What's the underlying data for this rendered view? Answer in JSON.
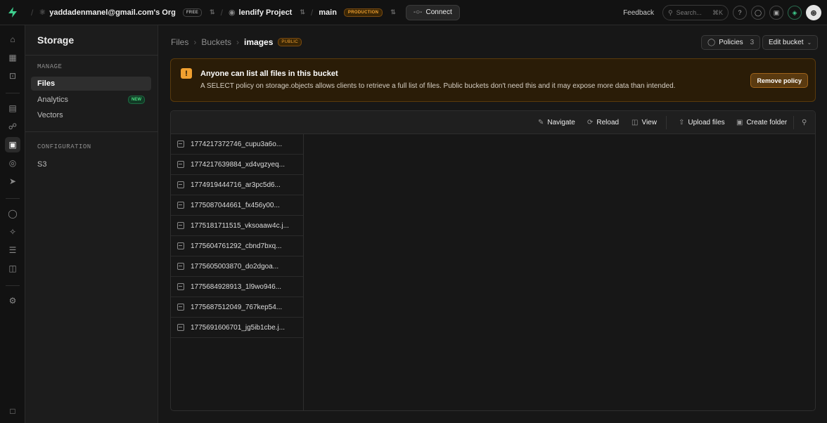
{
  "topbar": {
    "org_name": "yaddadenmanel@gmail.com's Org",
    "org_plan": "FREE",
    "project_name": "lendify Project",
    "branch_name": "main",
    "branch_badge": "PRODUCTION",
    "connect_label": "Connect",
    "feedback_label": "Feedback",
    "search_placeholder": "Search...",
    "search_shortcut": "⌘K",
    "avatar_initial": "⊛"
  },
  "sidebar": {
    "title": "Storage",
    "manage_label": "MANAGE",
    "items": [
      {
        "label": "Files"
      },
      {
        "label": "Analytics",
        "badge": "NEW"
      },
      {
        "label": "Vectors"
      }
    ],
    "configuration_label": "CONFIGURATION",
    "config_items": [
      {
        "label": "S3"
      }
    ]
  },
  "header": {
    "breadcrumb": [
      "Files",
      "Buckets",
      "images"
    ],
    "bucket_badge": "PUBLIC",
    "policies_label": "Policies",
    "policies_count": "3",
    "edit_bucket_label": "Edit bucket"
  },
  "warning": {
    "title": "Anyone can list all files in this bucket",
    "text": "A SELECT policy on storage.objects allows clients to retrieve a full list of files. Public buckets don't need this and it may expose more data than intended.",
    "button_label": "Remove policy"
  },
  "toolbar": {
    "navigate": "Navigate",
    "reload": "Reload",
    "view": "View",
    "upload": "Upload files",
    "create_folder": "Create folder"
  },
  "files": [
    "1774217372746_cupu3a6o...",
    "1774217639884_xd4vgzyeq...",
    "1774919444716_ar3pc5d6...",
    "1775087044661_fx456y00...",
    "1775181711515_vksoaaw4c.j...",
    "1775604761292_cbnd7bxq...",
    "1775605003870_do2dgoa...",
    "1775684928913_1l9wo946...",
    "1775687512049_767kep54...",
    "1775691606701_jg5ib1cbe.j..."
  ],
  "colors": {
    "accent": "#3ecf8e",
    "warning": "#f0a030",
    "new_badge": "#4ade80"
  }
}
